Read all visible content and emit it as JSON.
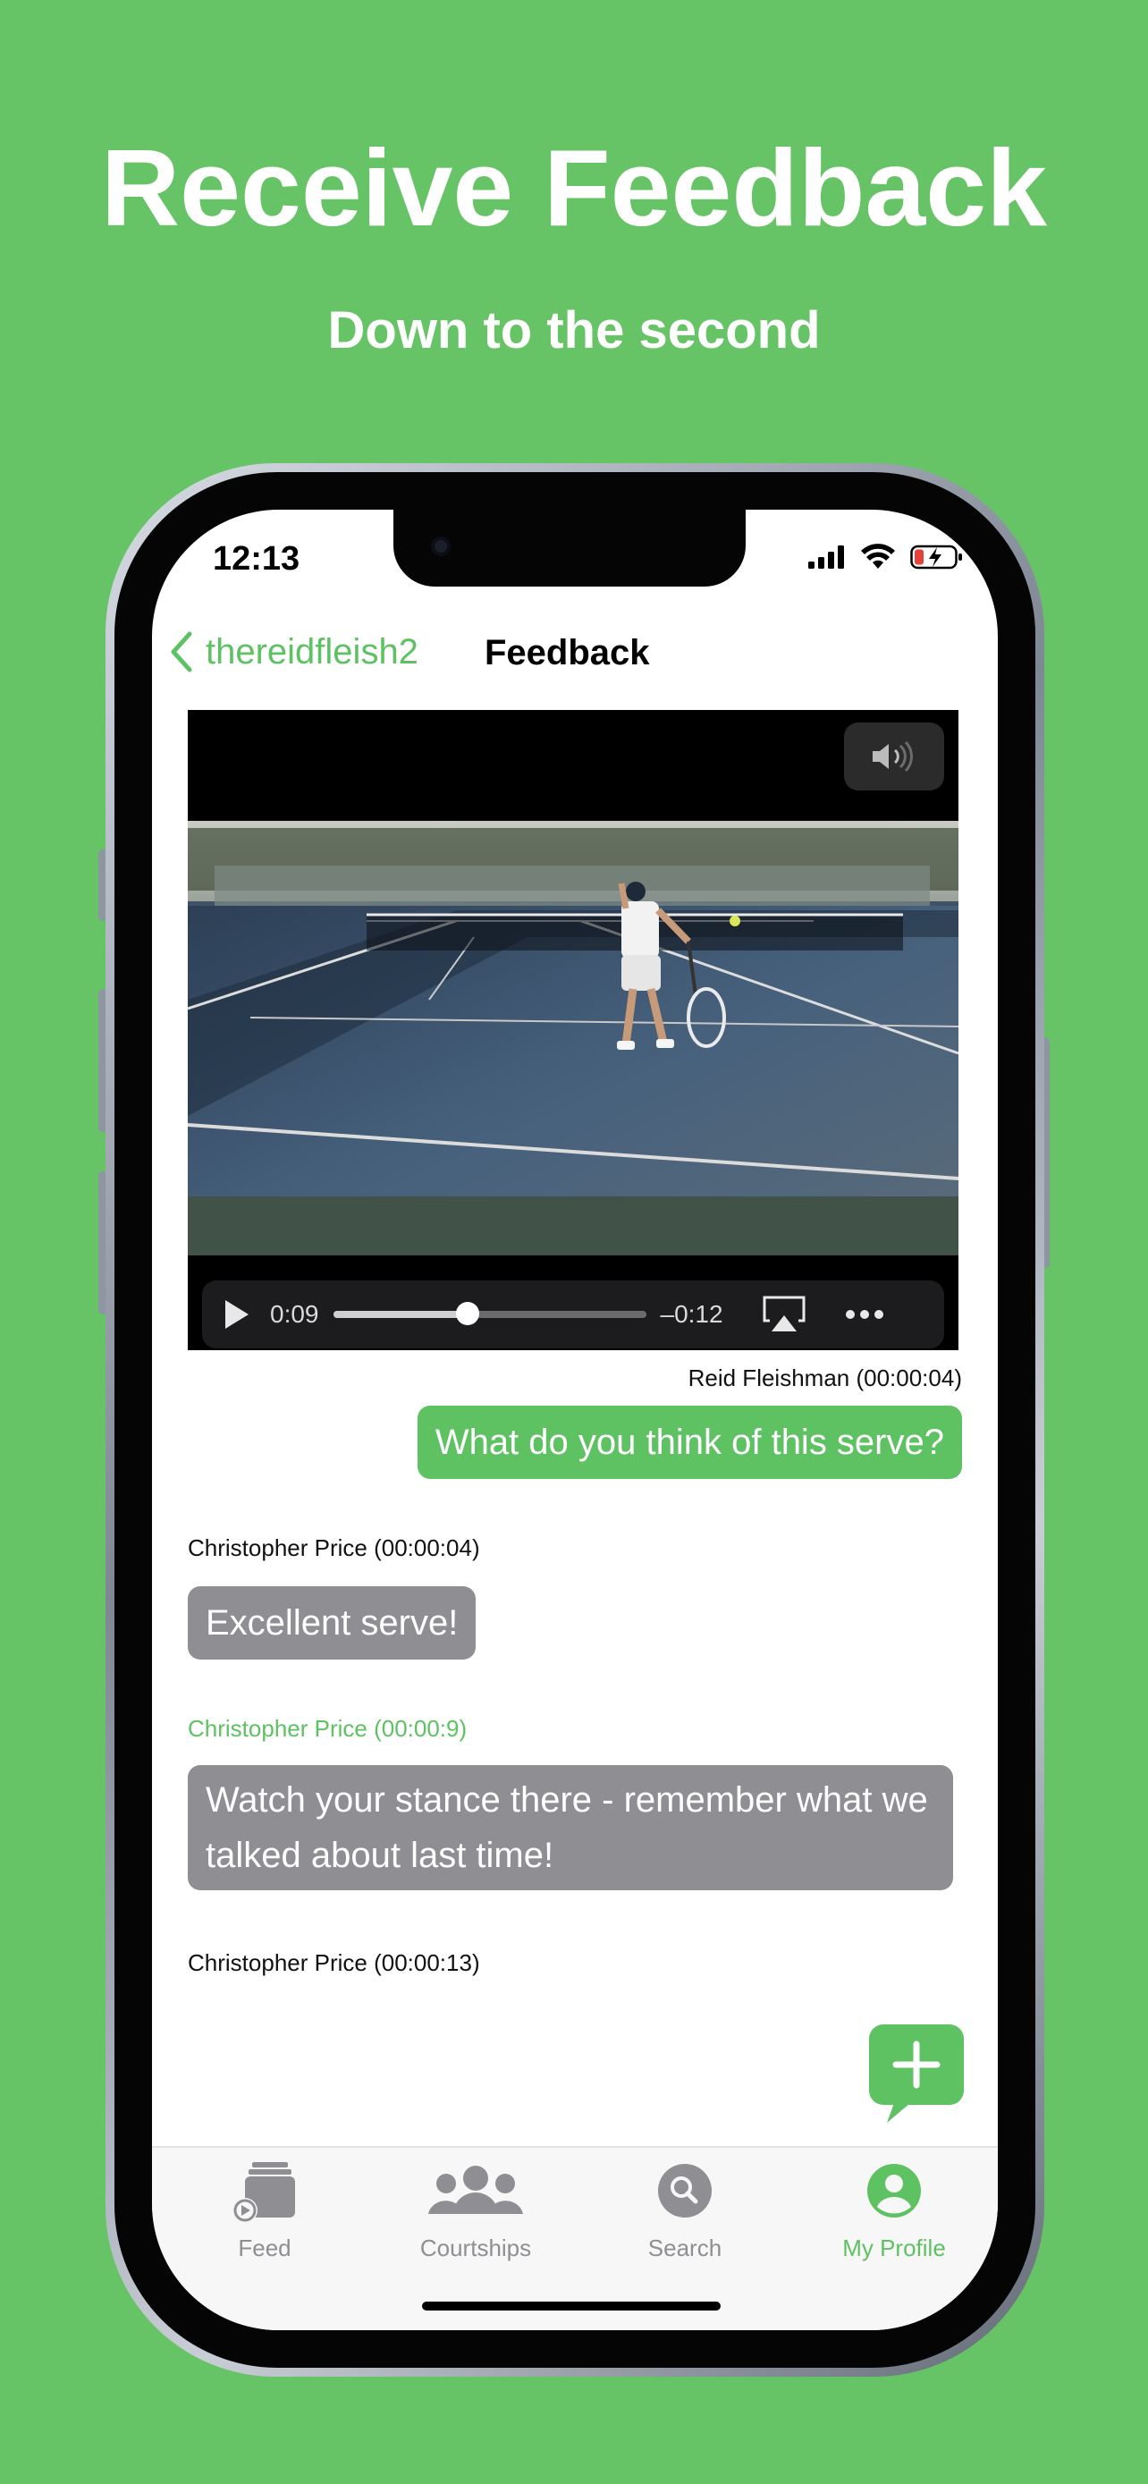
{
  "promo": {
    "headline": "Receive Feedback",
    "subline": "Down to the second"
  },
  "status_bar": {
    "time": "12:13",
    "icons": [
      "signal-icon",
      "wifi-icon",
      "battery-charging-icon"
    ]
  },
  "nav": {
    "back_label": "thereidfleish2",
    "title": "Feedback"
  },
  "video": {
    "elapsed": "0:09",
    "remaining": "–0:12",
    "progress": 0.43
  },
  "comments": [
    {
      "author_time": "Reid Fleishman (00:00:04)",
      "text": "What do you think of this serve?"
    },
    {
      "author_time": "Christopher Price (00:00:04)",
      "text": "Excellent serve!"
    },
    {
      "author_time": "Christopher Price (00:00:9)",
      "text": "Watch your stance there - remember what we talked about last time!"
    },
    {
      "author_time": "Christopher Price (00:00:13)"
    }
  ],
  "tabs": [
    {
      "label": "Feed",
      "icon": "feed-icon"
    },
    {
      "label": "Courtships",
      "icon": "group-icon"
    },
    {
      "label": "Search",
      "icon": "search-icon"
    },
    {
      "label": "My Profile",
      "icon": "profile-icon"
    }
  ],
  "colors": {
    "background": "#67c466",
    "accent": "#5ec263",
    "gray_bubble": "#8e8e93"
  }
}
